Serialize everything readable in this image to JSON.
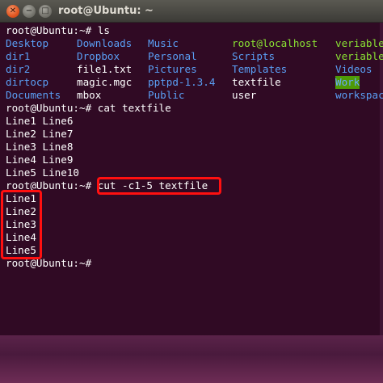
{
  "window": {
    "title": "root@Ubuntu: ~",
    "close_glyph": "✕",
    "min_glyph": "−",
    "max_glyph": "□"
  },
  "terminal": {
    "lines": [
      "root@Ubuntu:~# ls",
      "root@Ubuntu:~# cat textfile",
      "Line1 Line6",
      "Line2 Line7",
      "Line3 Line8",
      "Line4 Line9",
      "Line5 Line10",
      "root@Ubuntu:~# cut -c1-5 textfile",
      "Line1",
      "Line2",
      "Line3",
      "Line4",
      "Line5",
      "root@Ubuntu:~#"
    ],
    "ls_output": [
      [
        "Desktop",
        "Downloads",
        "Music",
        "root@localhost",
        "veriable"
      ],
      [
        "dir1",
        "Dropbox",
        "Personal",
        "Scripts",
        "veriable"
      ],
      [
        "dir2",
        "file1.txt",
        "Pictures",
        "Templates",
        "Videos"
      ],
      [
        "dirtocp",
        "magic.mgc",
        "pptpd-1.3.4",
        "textfile",
        "Work"
      ],
      [
        "Documents",
        "mbox",
        "Public",
        "user",
        "workspac"
      ]
    ]
  },
  "colors": {
    "terminal_bg": "#300a24",
    "directory": "#5a9ff5",
    "executable": "#8ae234",
    "highlight_box": "#ff1010"
  }
}
